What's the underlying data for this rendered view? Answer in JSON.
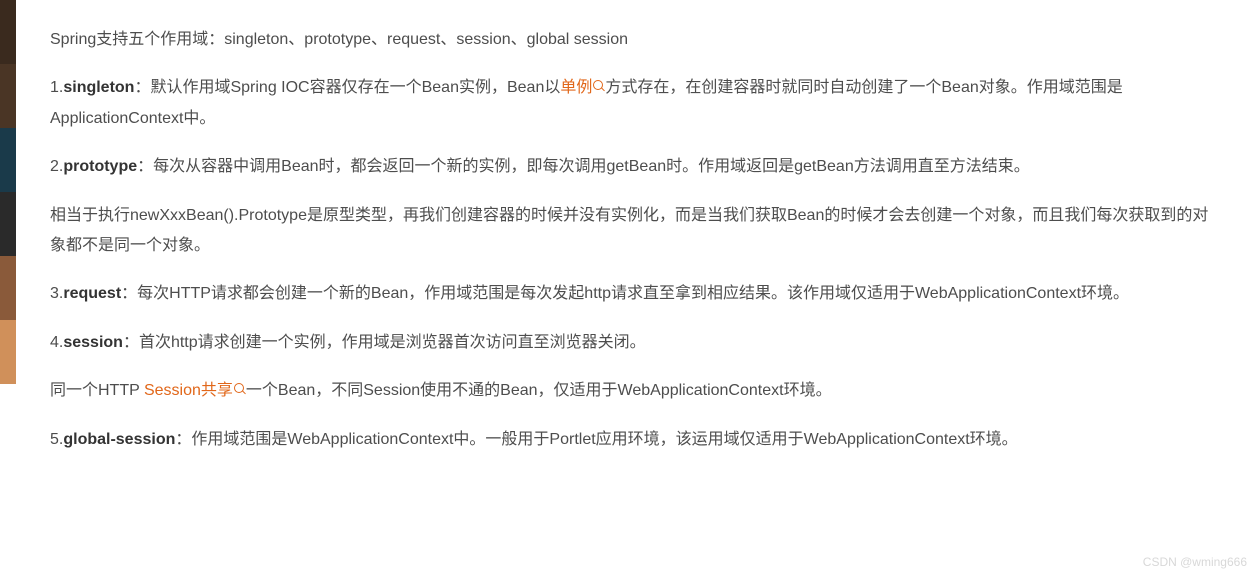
{
  "intro": "Spring支持五个作用域：singleton、prototype、request、session、global session",
  "items": [
    {
      "num": "1.",
      "term": "singleton",
      "colon": "：",
      "pre": "默认作用域Spring IOC容器仅存在一个Bean实例，Bean以",
      "link": "单例",
      "post": "方式存在，在创建容器时就同时自动创建了一个Bean对象。作用域范围是ApplicationContext中。"
    },
    {
      "num": "2.",
      "term": "prototype",
      "colon": "：",
      "text": "每次从容器中调用Bean时，都会返回一个新的实例，即每次调用getBean时。作用域返回是getBean方法调用直至方法结束。"
    }
  ],
  "prototype_extra": "相当于执行newXxxBean().Prototype是原型类型，再我们创建容器的时候并没有实例化，而是当我们获取Bean的时候才会去创建一个对象，而且我们每次获取到的对象都不是同一个对象。",
  "request": {
    "num": "3.",
    "term": "request",
    "colon": "：",
    "text": "每次HTTP请求都会创建一个新的Bean，作用域范围是每次发起http请求直至拿到相应结果。该作用域仅适用于WebApplicationContext环境。"
  },
  "session": {
    "num": "4.",
    "term": "session",
    "colon": "：",
    "text": "首次http请求创建一个实例，作用域是浏览器首次访问直至浏览器关闭。"
  },
  "session_extra": {
    "pre": "同一个HTTP",
    "link": "Session共享",
    "post": "一个Bean，不同Session使用不通的Bean，仅适用于WebApplicationContext环境。"
  },
  "global": {
    "num": "5.",
    "term": "global-session",
    "colon": "：",
    "text": "作用域范围是WebApplicationContext中。一般用于Portlet应用环境，该运用域仅适用于WebApplicationContext环境。"
  },
  "watermark": "CSDN @wming666"
}
